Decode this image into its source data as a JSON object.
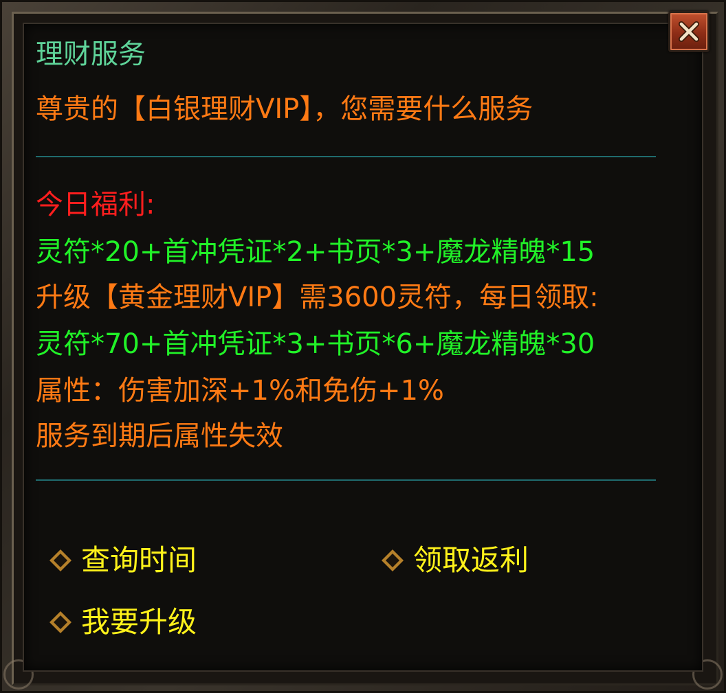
{
  "dialog": {
    "title": "理财服务",
    "greeting": "尊贵的【白银理财VIP】，您需要什么服务",
    "benefit_heading": "今日福利:",
    "lines": [
      "灵符*20+首冲凭证*2+书页*3+魔龙精魄*15",
      "升级【黄金理财VIP】需3600灵符，每日领取:",
      "灵符*70+首冲凭证*3+书页*6+魔龙精魄*30",
      "属性：伤害加深+1%和免伤+1%",
      "服务到期后属性失效"
    ]
  },
  "options": {
    "query_time": "查询时间",
    "claim_rebate": "领取返利",
    "upgrade": "我要升级"
  },
  "icons": {
    "close": "close-icon",
    "option_bullet": "diamond-bullet-icon"
  },
  "colors": {
    "title": "#5fd49a",
    "orange_text": "#ff7a14",
    "red_heading": "#ff1e1e",
    "green_text": "#21f228",
    "option_text": "#fff21a",
    "divider": "#1f6b6e"
  }
}
